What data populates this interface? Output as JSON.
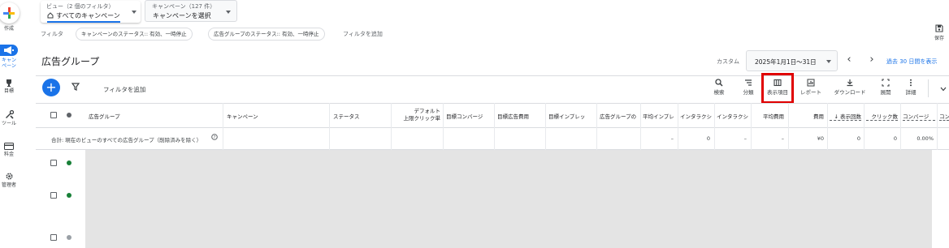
{
  "rail": {
    "create": "作成",
    "campaigns": "キャンペーン",
    "goals": "目標",
    "tools": "ツール",
    "billing": "料金",
    "admin": "管理者"
  },
  "view": {
    "small": "ビュー（2 個のフィルタ）",
    "selected": "すべてのキャンペーン"
  },
  "campaign_select": {
    "small": "キャンペーン（127 件）",
    "selected": "キャンペーンを選択"
  },
  "filters": {
    "label": "フィルタ",
    "chips": [
      "キャンペーンのステータス:: 有効、一時停止",
      "広告グループのステータス:: 有効、一時停止"
    ],
    "add": "フィルタを追加"
  },
  "save_label": "保存",
  "title": "広告グループ",
  "date": {
    "custom": "カスタム",
    "range": "2025年1月1日〜31日",
    "last30": "過去 30 日間を表示"
  },
  "toolbar": {
    "add_filter": "フィルタを追加",
    "search": "検索",
    "segment": "分類",
    "columns": "表示項目",
    "report": "レポート",
    "download": "ダウンロード",
    "expand": "展開",
    "details": "詳細"
  },
  "table": {
    "headers": {
      "ad_group": "広告グループ",
      "campaign": "キャンペーン",
      "status": "ステータス",
      "default_bid_1": "デフォルト",
      "default_bid_2": "上限クリック単",
      "target_conv": "目標コンバージ",
      "target_roas": "目標広告費用",
      "target_imp": "目標インプレッ",
      "ad_group_type": "広告グループの",
      "avg_imp": "平均インプレ",
      "interactions": "インタラクシ",
      "interaction_rate": "インタラクシ",
      "avg_cost": "平均費用",
      "cost": "費用",
      "impressions": "↓ 表示回数",
      "clicks": "クリック数",
      "conversions": "コンバージ",
      "conv_rate": "コン"
    },
    "summary": {
      "label": "合計: 現在のビューのすべての広告グループ（削除済みを除く）",
      "avg_imp": "–",
      "interactions": "0",
      "interaction_rate": "–",
      "avg_cost": "–",
      "cost": "¥0",
      "impressions": "0",
      "clicks": "0",
      "conversions": "0.00%"
    }
  },
  "colors": {
    "accent": "#1a73e8",
    "highlight": "#e00000",
    "active_dot": "#188038",
    "removed_dot": "#9aa0a6"
  }
}
